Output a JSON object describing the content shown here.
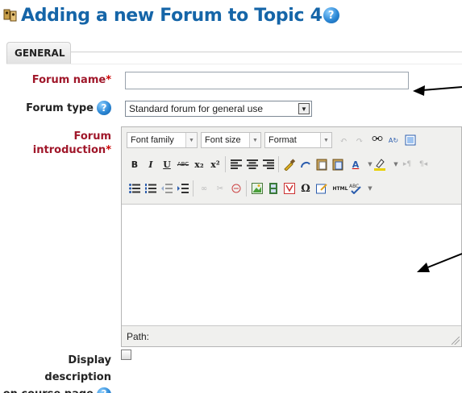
{
  "page": {
    "title": "Adding a new Forum to Topic 4",
    "help_glyph": "?"
  },
  "section": {
    "legend": "GENERAL"
  },
  "fields": {
    "forum_name": {
      "label": "Forum name",
      "required": "*",
      "value": ""
    },
    "forum_type": {
      "label": "Forum type",
      "selected": "Standard forum for general use"
    },
    "forum_intro": {
      "label_line1": "Forum",
      "label_line2": "introduction",
      "required": "*"
    },
    "display_description": {
      "label_line1": "Display description",
      "label_line2": "on course page",
      "checked": false
    }
  },
  "editor": {
    "font_family": "Font family",
    "font_size": "Font size",
    "format": "Format",
    "path_label": "Path:",
    "bold": "B",
    "italic": "I",
    "underline": "U",
    "strike": "ABC",
    "subscript": "x₂",
    "superscript": "x²",
    "omega": "Ω",
    "text_color": "A",
    "html": "HTML"
  },
  "colors": {
    "title": "#1565a8",
    "label_required": "#a0172a",
    "help": "#2c88d6"
  }
}
